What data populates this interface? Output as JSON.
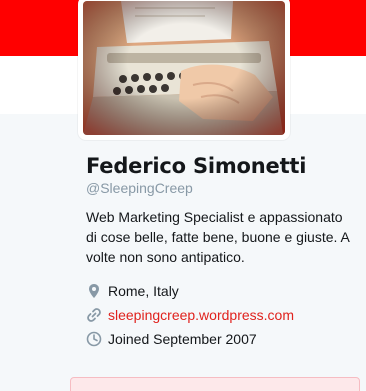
{
  "profile": {
    "name": "Federico Simonetti",
    "handle": "@SleepingCreep",
    "bio": "Web Marketing Specialist e appassionato di cose belle, fatte bene, buone e giuste. A volte non sono antipatico.",
    "location": "Rome, Italy",
    "website": "sleepingcreep.wordpress.com",
    "joined": "Joined September 2007"
  },
  "icons": {
    "location": "map-pin-icon",
    "website": "link-icon",
    "joined": "clock-icon"
  },
  "colors": {
    "banner": "#ff0000",
    "link": "#e0221d",
    "text": "#14171a",
    "muted": "#8899a6",
    "page_bg": "#f5f8fa"
  }
}
